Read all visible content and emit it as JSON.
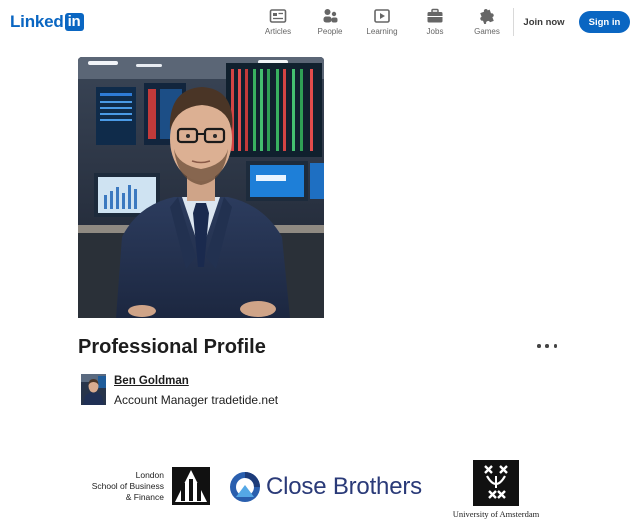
{
  "nav": {
    "logo_text": "Linked",
    "logo_box": "in",
    "items": [
      {
        "label": "Articles",
        "icon": "articles-icon"
      },
      {
        "label": "People",
        "icon": "people-icon"
      },
      {
        "label": "Learning",
        "icon": "learning-icon"
      },
      {
        "label": "Jobs",
        "icon": "jobs-icon"
      },
      {
        "label": "Games",
        "icon": "games-icon"
      }
    ],
    "join_label": "Join now",
    "signin_label": "Sign in"
  },
  "post": {
    "title": "Professional Profile",
    "author_name": "Ben Goldman",
    "author_headline": "Account Manager tradetide.net"
  },
  "logos": {
    "lsbf_lines": [
      "London",
      "School of Business",
      "& Finance"
    ],
    "close_brothers": "Close Brothers",
    "uva": "University of Amsterdam"
  },
  "colors": {
    "brand_blue": "#0a66c2",
    "close_brothers_navy": "#2a3a78"
  }
}
